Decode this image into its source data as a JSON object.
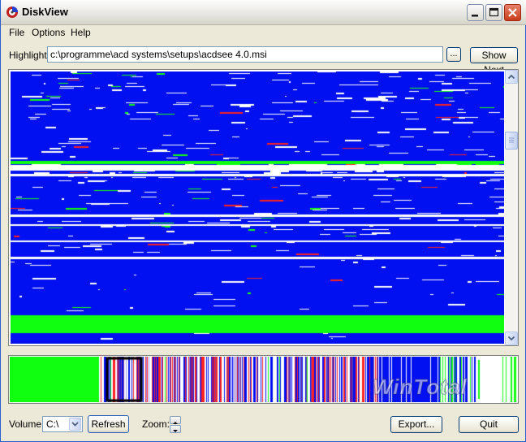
{
  "window": {
    "title": "DiskView",
    "controls": {
      "minimize": "minimize-icon",
      "maximize": "maximize-icon",
      "close": "close-icon"
    }
  },
  "menu": [
    "File",
    "Options",
    "Help"
  ],
  "highlight": {
    "label": "Highlight:",
    "value": "c:\\programme\\acd systems\\setups\\acdsee 4.0.msi",
    "browse_label": "...",
    "show_next_label": "Show Next"
  },
  "map": {
    "colors": {
      "blue": "#0010f0",
      "green": "#10ff10",
      "white": "#ffffff",
      "red": "#ff2020",
      "black": "#000000"
    }
  },
  "overview": {
    "watermark": "WinTotal"
  },
  "bottom": {
    "volume_label": "Volume:",
    "volume_value": "C:\\",
    "refresh_label": "Refresh",
    "zoom_label": "Zoom:",
    "export_label": "Export...",
    "quit_label": "Quit"
  }
}
